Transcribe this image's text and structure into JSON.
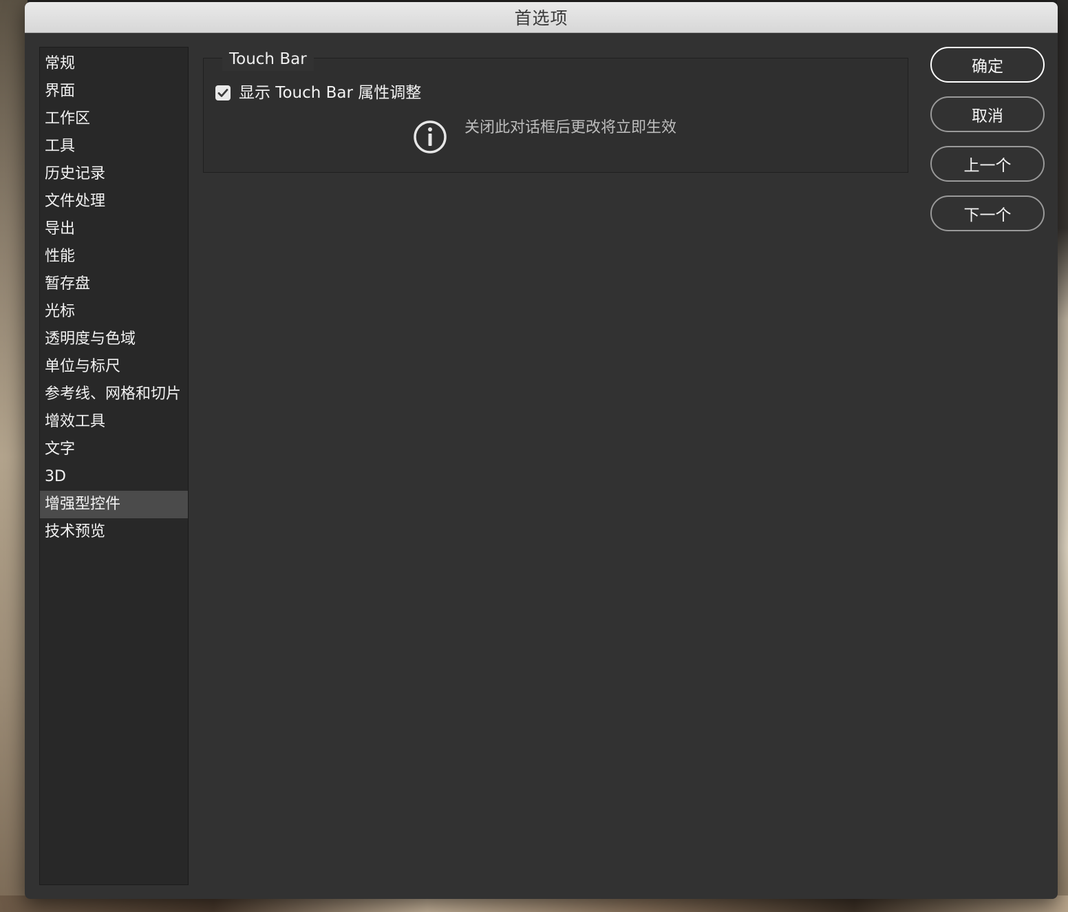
{
  "dialog": {
    "title": "首选项"
  },
  "sidebar": {
    "items": [
      {
        "label": "常规"
      },
      {
        "label": "界面"
      },
      {
        "label": "工作区"
      },
      {
        "label": "工具"
      },
      {
        "label": "历史记录"
      },
      {
        "label": "文件处理"
      },
      {
        "label": "导出"
      },
      {
        "label": "性能"
      },
      {
        "label": "暂存盘"
      },
      {
        "label": "光标"
      },
      {
        "label": "透明度与色域"
      },
      {
        "label": "单位与标尺"
      },
      {
        "label": "参考线、网格和切片"
      },
      {
        "label": "增效工具"
      },
      {
        "label": "文字"
      },
      {
        "label": "3D"
      },
      {
        "label": "增强型控件",
        "selected": true
      },
      {
        "label": "技术预览"
      }
    ]
  },
  "touchbar": {
    "group_title": "Touch Bar",
    "checkbox_label": "显示 Touch Bar 属性调整",
    "checkbox_checked": true,
    "info_text": "关闭此对话框后更改将立即生效",
    "info_icon": "info-circle-icon"
  },
  "buttons": {
    "ok": "确定",
    "cancel": "取消",
    "prev": "上一个",
    "next": "下一个"
  },
  "colors": {
    "dialog_bg": "#323232",
    "sidebar_bg": "#282828",
    "selected_bg": "#4b4b4b",
    "text": "#f2f2f2"
  }
}
